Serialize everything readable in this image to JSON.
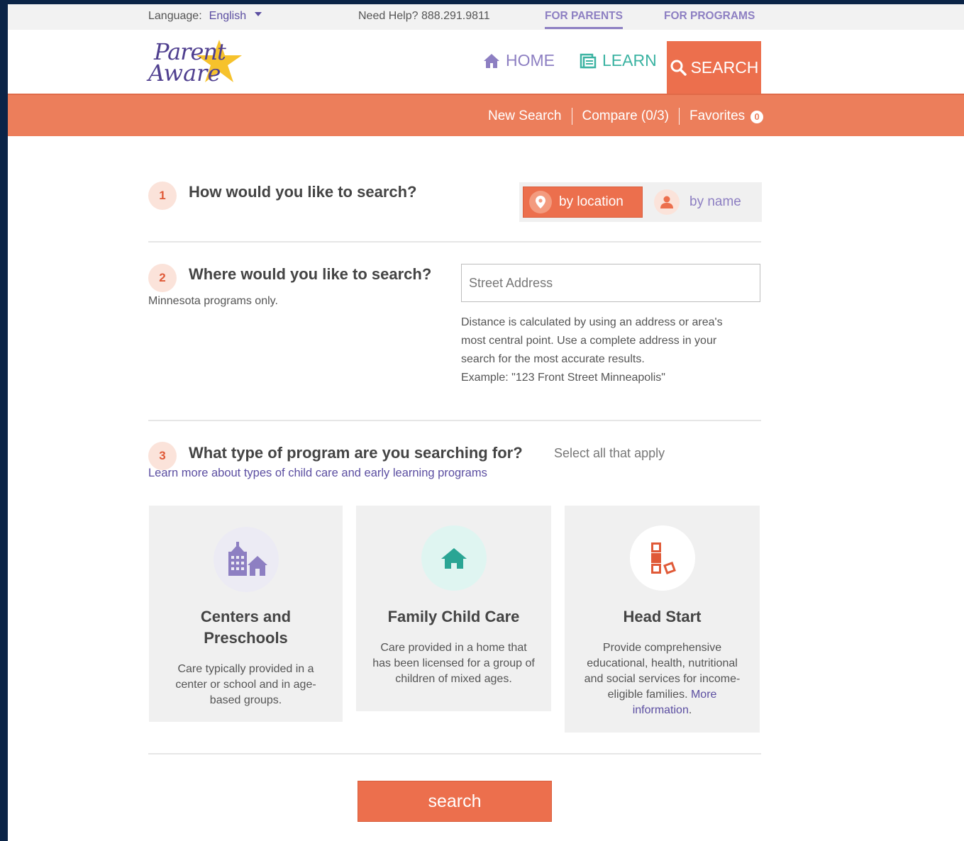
{
  "utility_bar": {
    "language_label": "Language:",
    "language_value": "English",
    "help_text": "Need Help? 888.291.9811",
    "for_parents": "FOR PARENTS",
    "for_programs": "FOR PROGRAMS"
  },
  "logo": {
    "line1": "Parent",
    "line2": "Aware"
  },
  "nav": {
    "home": "HOME",
    "learn": "LEARN",
    "search": "SEARCH"
  },
  "subnav": {
    "new_search": "New Search",
    "compare": "Compare (0/3)",
    "favorites": "Favorites",
    "favorites_count": "0"
  },
  "step1": {
    "number": "1",
    "title": "How would you like to search?",
    "by_location": "by location",
    "by_name": "by name"
  },
  "step2": {
    "number": "2",
    "title": "Where would you like to search?",
    "note": "Minnesota programs only.",
    "address_placeholder": "Street Address",
    "help_line1": "Distance is calculated by using an address or area's",
    "help_line2": "most central point. Use a complete address in your",
    "help_line3": "search for the most accurate results.",
    "help_line4": "Example: \"123 Front Street Minneapolis\""
  },
  "step3": {
    "number": "3",
    "title": "What type of program are you searching for?",
    "select_all": "Select all that apply",
    "learn_more": "Learn more about types of child care and early learning programs",
    "cards": [
      {
        "title_line1": "Centers and",
        "title_line2": "Preschools",
        "desc_line1": "Care typically provided in a",
        "desc_line2": "center or school and in age-",
        "desc_line3": "based groups."
      },
      {
        "title": "Family Child Care",
        "desc_line1": "Care provided in a home that",
        "desc_line2": "has been licensed for a group of",
        "desc_line3": "children of mixed ages."
      },
      {
        "title": "Head Start",
        "desc_line1": "Provide comprehensive",
        "desc_line2": "educational, health, nutritional",
        "desc_line3": "and social services for income-",
        "desc_line4": "eligible families.",
        "more_link_1": "More",
        "more_link_2": "information",
        "desc_end": "."
      }
    ]
  },
  "search_button": "search",
  "colors": {
    "brand_orange": "#ec6f4d",
    "brand_purple": "#8d7fc2",
    "link_purple": "#5b4ea1",
    "teal": "#3bb3a2"
  }
}
